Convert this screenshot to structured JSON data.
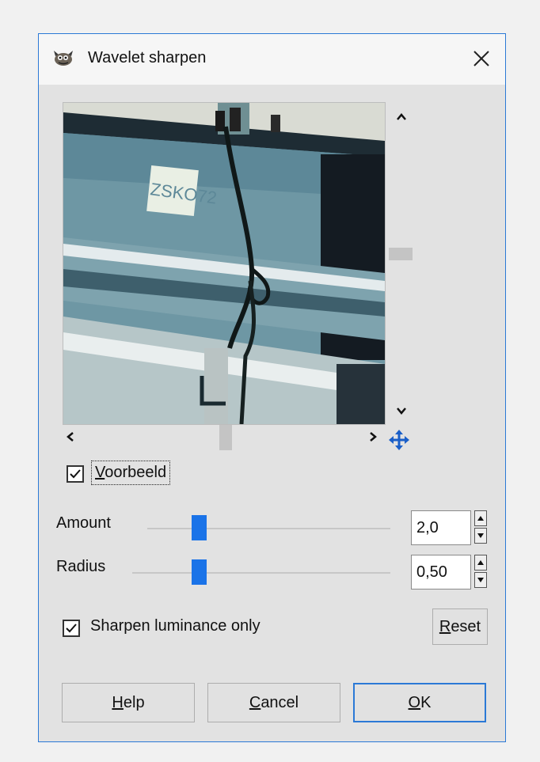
{
  "window": {
    "title": "Wavelet sharpen",
    "app_icon": "gimp-wilber-icon",
    "close_icon": "close-icon"
  },
  "preview": {
    "image_text": "ZSKO72",
    "toggle_label_underlined": "V",
    "toggle_label_rest": "oorbeeld",
    "toggle_checked": true,
    "navigate_icon": "move-arrows-icon"
  },
  "amount": {
    "label": "Amount",
    "value": "2,0",
    "slider_level": 0.2
  },
  "radius": {
    "label": "Radius",
    "value": "0,50",
    "slider_level": 0.25
  },
  "luminance": {
    "label": "Sharpen luminance only",
    "checked": true
  },
  "buttons": {
    "reset_mn": "R",
    "reset_rest": "eset",
    "help_mn": "H",
    "help_rest": "elp",
    "cancel_mn": "C",
    "cancel_rest": "ancel",
    "ok_mn": "O",
    "ok_rest": "K"
  },
  "colors": {
    "accent": "#1a73e8",
    "focus_border": "#2b79d6",
    "dialog_bg": "#e2e2e2"
  }
}
